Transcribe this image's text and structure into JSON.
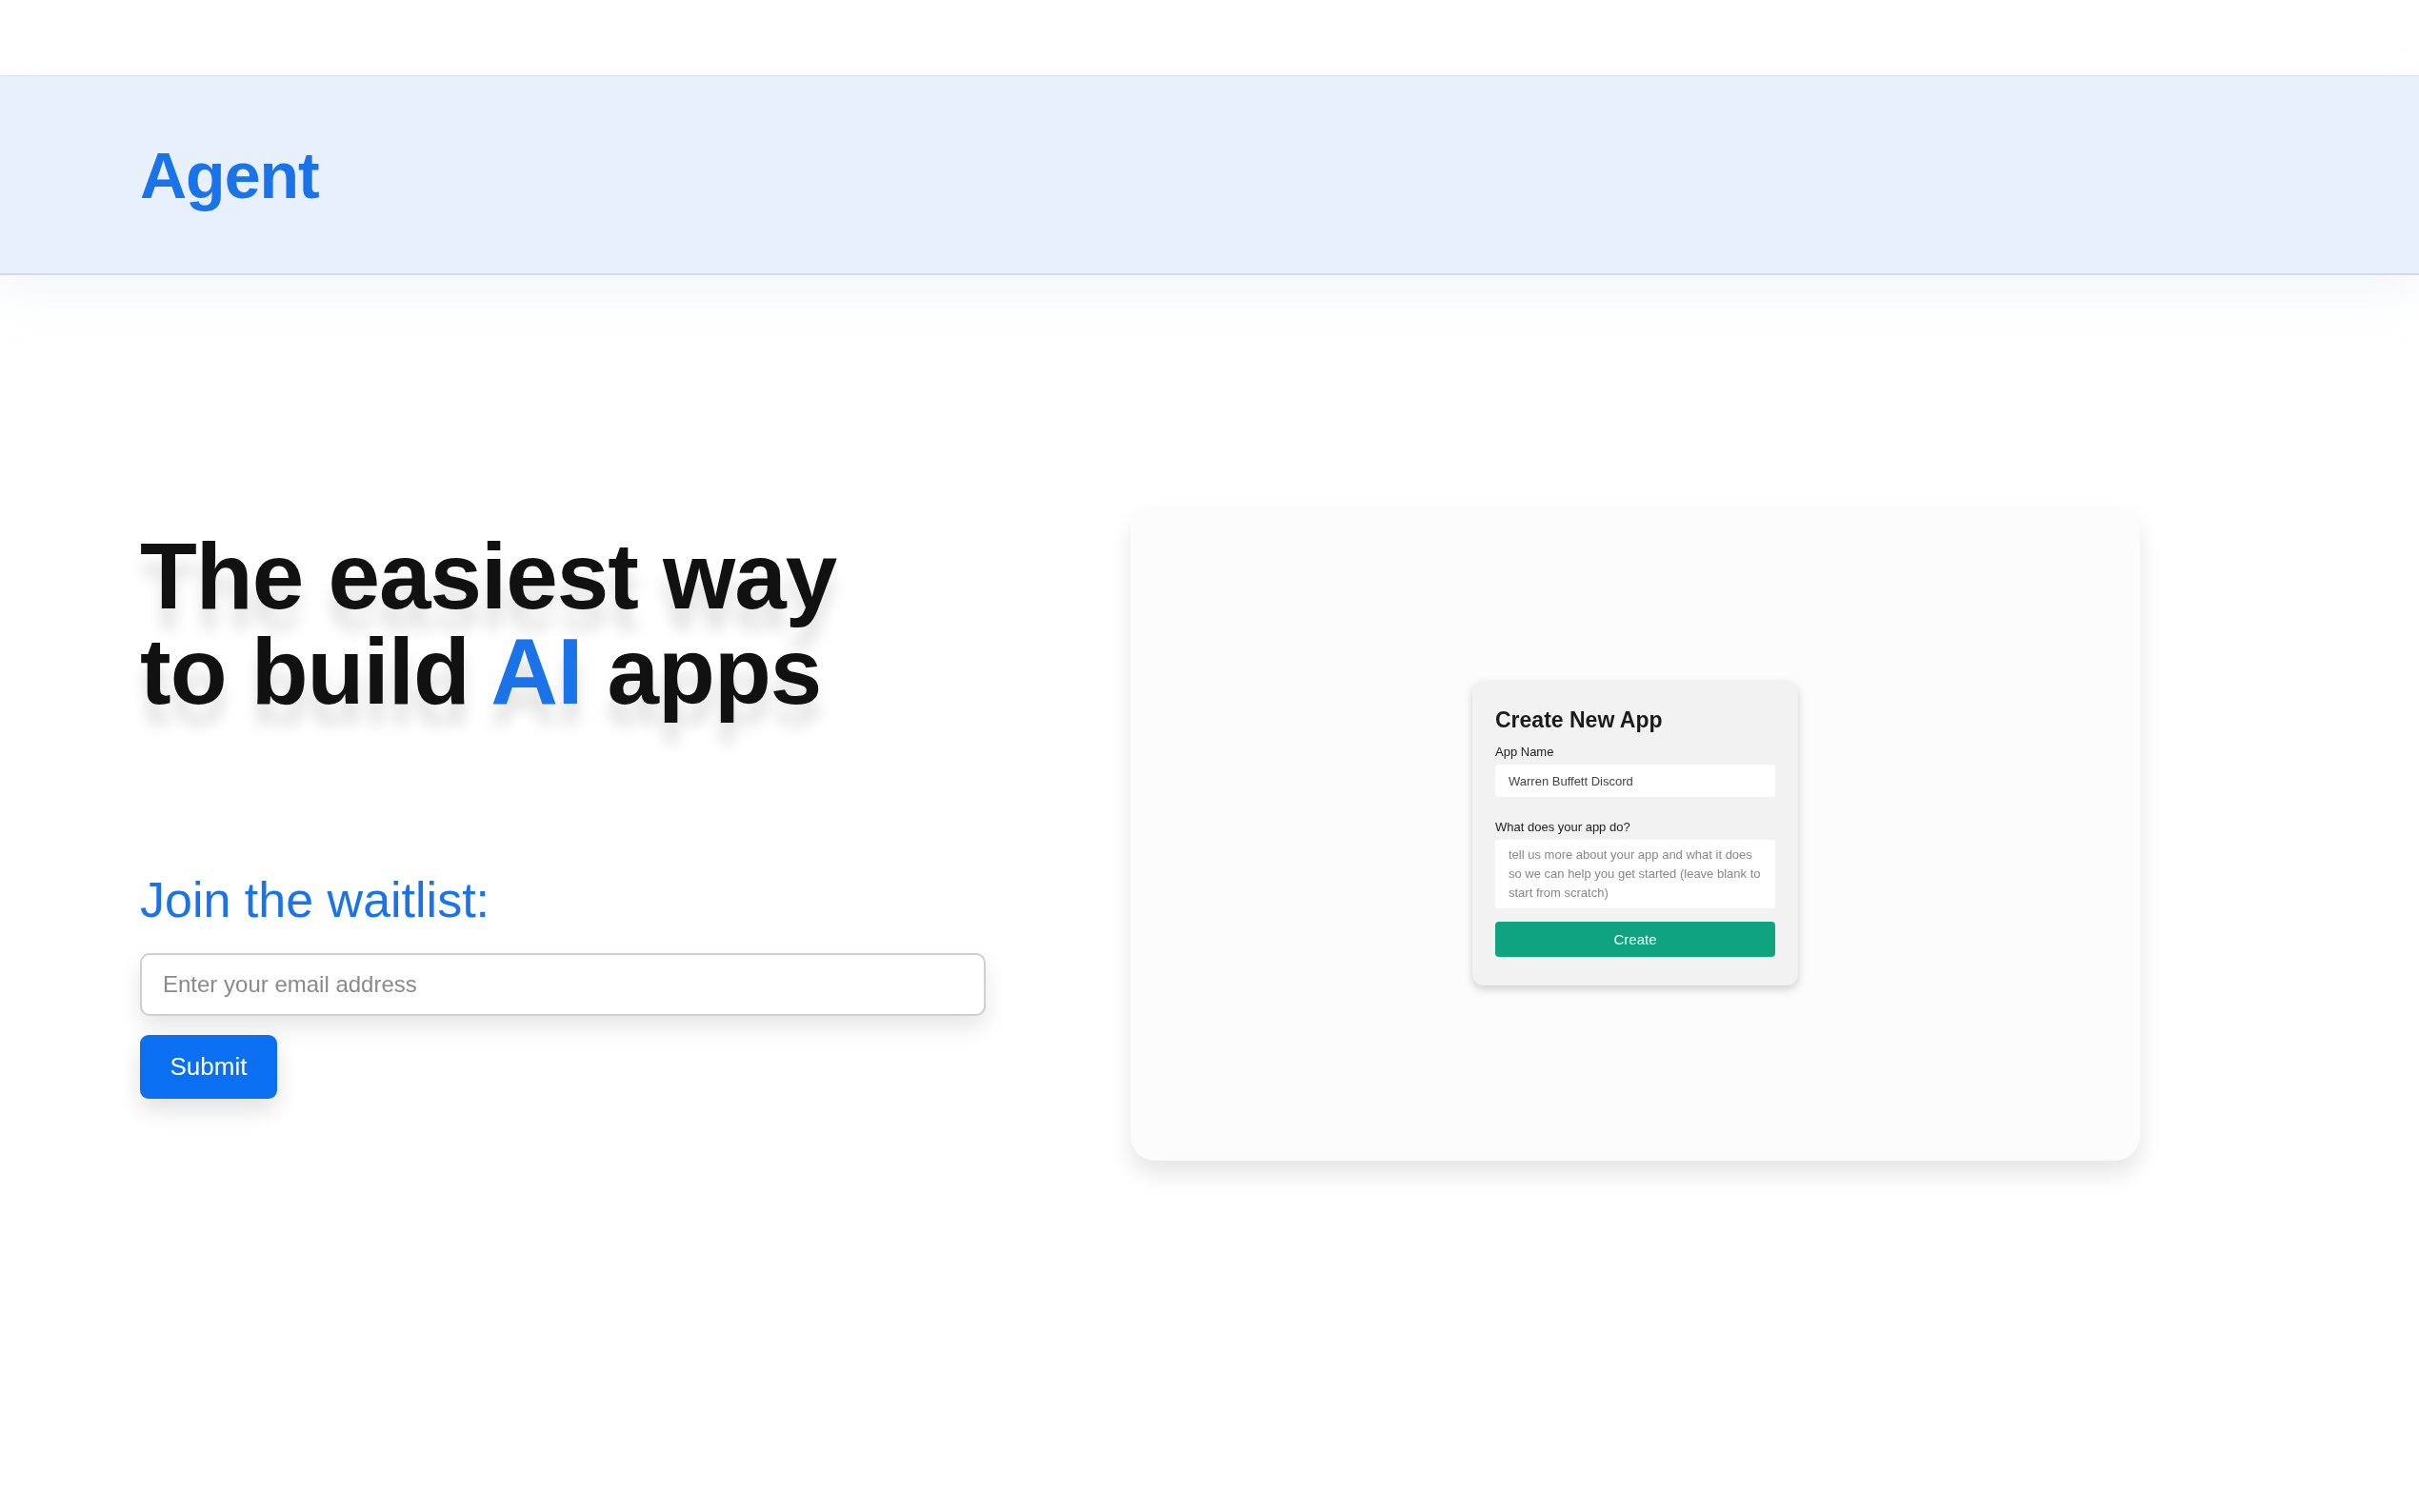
{
  "header": {
    "logo": "Agent"
  },
  "hero": {
    "headline": [
      {
        "text": "The easiest way to build ",
        "accent": false
      },
      {
        "text": "AI",
        "accent": true
      },
      {
        "text": " apps",
        "accent": false
      }
    ],
    "waitlist": {
      "heading": "Join the waitlist:",
      "email": {
        "placeholder": "Enter your email address"
      },
      "button": "Submit"
    }
  },
  "preview": {
    "title": "Create New App",
    "fields": [
      {
        "kind": "input",
        "label": "App Name",
        "value": "Warren Buffett Discord"
      },
      {
        "kind": "textarea",
        "label": "What does your app do?",
        "placeholder": "tell us more about your app and what it does so we can help you get started (leave blank to start from scratch)"
      }
    ],
    "button": "Create"
  }
}
